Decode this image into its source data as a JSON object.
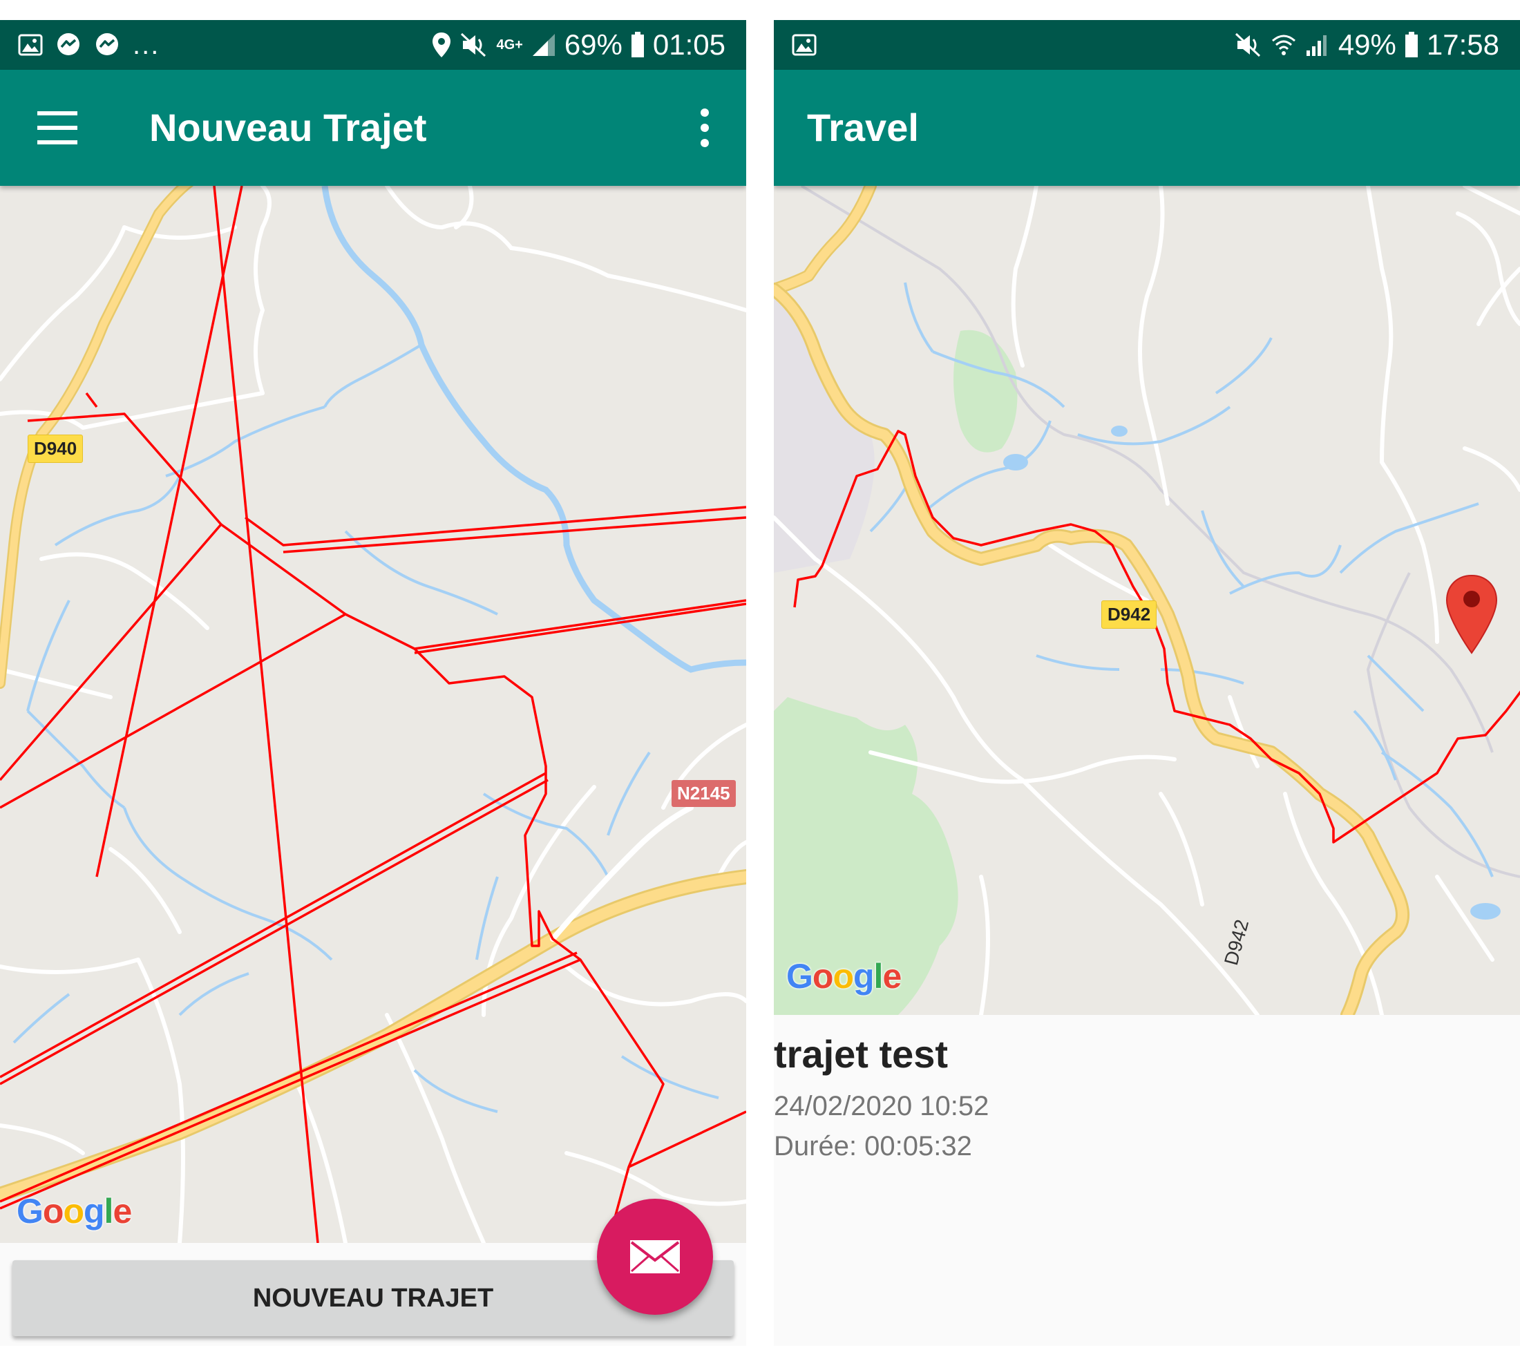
{
  "left_screen": {
    "status_bar": {
      "left_icons": [
        "image-icon",
        "messenger-icon",
        "messenger-icon"
      ],
      "more_indicator": "...",
      "network_label": "4G+",
      "battery": "69%",
      "time": "01:05"
    },
    "app_bar": {
      "title": "Nouveau Trajet",
      "menu_icon": "hamburger-menu-icon",
      "more_icon": "more-vert-icon"
    },
    "map": {
      "road_labels": [
        "D940",
        "N2145"
      ],
      "attribution": "Google"
    },
    "new_trip_button": "NOUVEAU TRAJET",
    "fab_icon": "mail-icon"
  },
  "right_screen": {
    "status_bar": {
      "left_icons": [
        "image-icon"
      ],
      "battery": "49%",
      "time": "17:58"
    },
    "app_bar": {
      "title": "Travel"
    },
    "map": {
      "road_labels": [
        "D942",
        "D942"
      ],
      "attribution": "Google",
      "marker_icon": "map-pin-icon"
    },
    "trip": {
      "name": "trajet test",
      "date": "24/02/2020 10:52",
      "duration": "Durée: 00:05:32"
    }
  },
  "colors": {
    "status_bar": "#00574b",
    "app_bar": "#018577",
    "route": "#ff0000",
    "fab": "#d81b60",
    "map_bg": "#ebe9e4",
    "water": "#a4d0f5",
    "major_road": "#fddc8a",
    "park": "#cdeac7"
  }
}
